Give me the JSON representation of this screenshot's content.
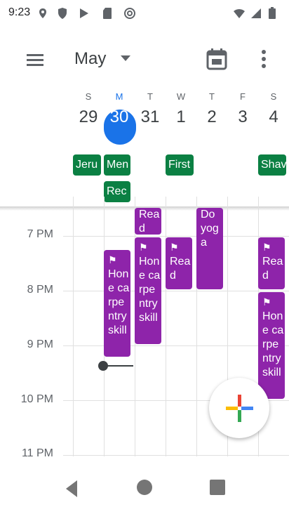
{
  "status": {
    "time": "9:23"
  },
  "header": {
    "month": "May"
  },
  "days": [
    {
      "dow": "S",
      "num": "29"
    },
    {
      "dow": "M",
      "num": "30",
      "today": true
    },
    {
      "dow": "T",
      "num": "31"
    },
    {
      "dow": "W",
      "num": "1"
    },
    {
      "dow": "T",
      "num": "2"
    },
    {
      "dow": "F",
      "num": "3"
    },
    {
      "dow": "S",
      "num": "4"
    }
  ],
  "allday": [
    {
      "label": "Jeru"
    },
    {
      "label": "Men"
    },
    {
      "label": "Rec"
    },
    {
      "label": "First"
    },
    {
      "label": "Shav"
    }
  ],
  "hours": [
    "7 PM",
    "8 PM",
    "9 PM",
    "10 PM",
    "11 PM"
  ],
  "events": [
    {
      "label": "Read"
    },
    {
      "label": "Do yoga"
    },
    {
      "label": "Hone carpentry skill"
    },
    {
      "label": "Hone carpentry skill"
    },
    {
      "label": "Read"
    },
    {
      "label": "Read"
    },
    {
      "label": "Hone carpentry skill"
    }
  ],
  "colors": {
    "accent": "#1a73e8",
    "event": "#8e24aa",
    "allday": "#0b8043"
  }
}
